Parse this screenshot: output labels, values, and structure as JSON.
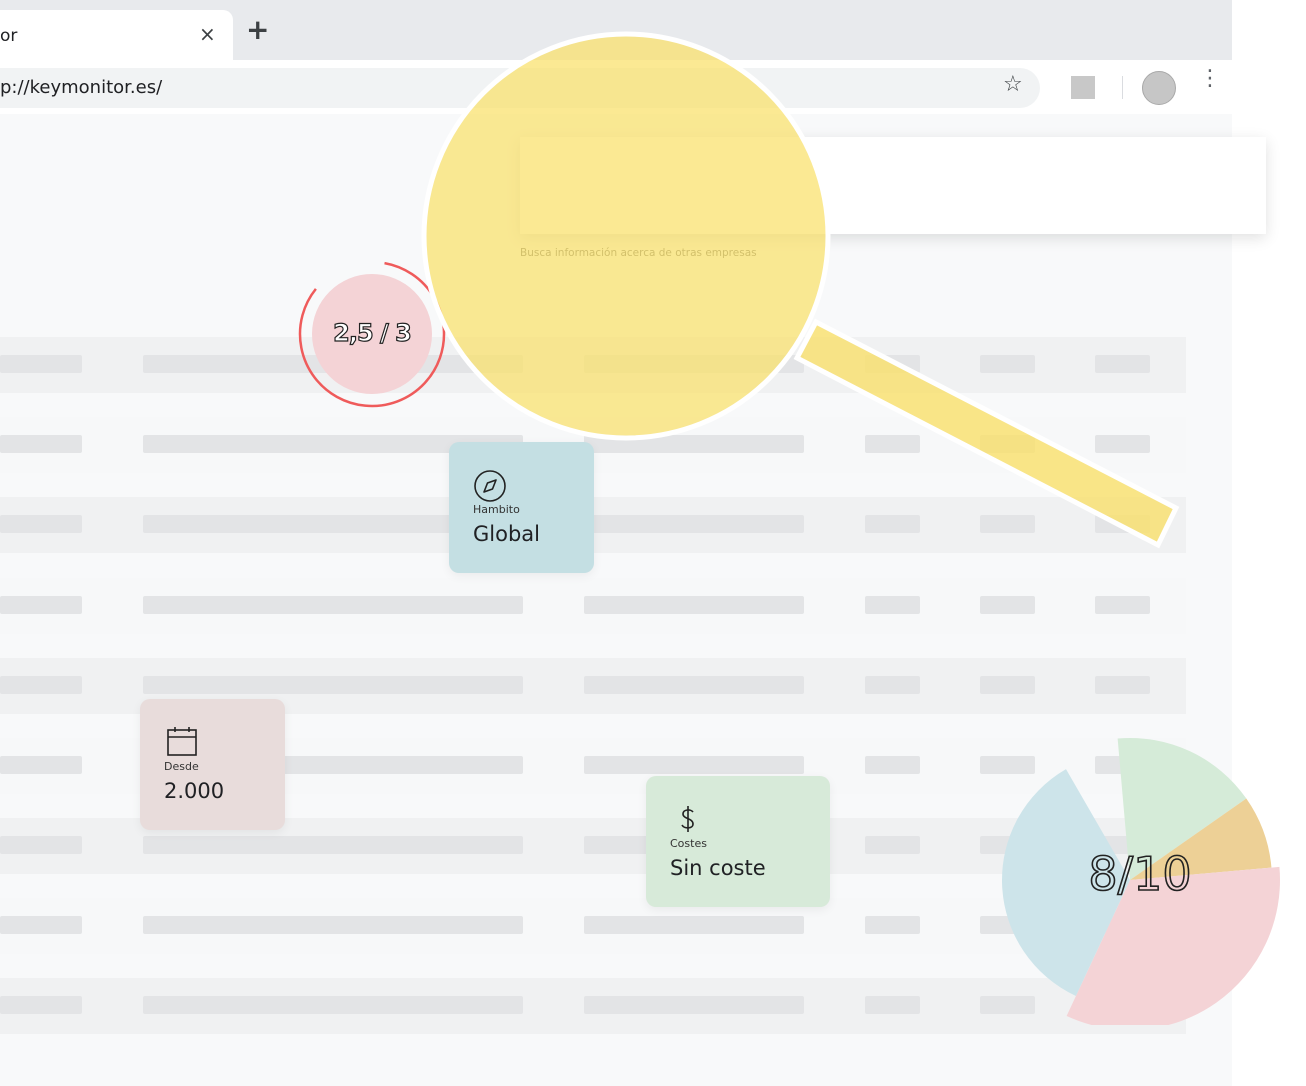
{
  "browser": {
    "tab_title": "or",
    "close_glyph": "×",
    "new_tab_glyph": "+",
    "url": "p://keymonitor.es/",
    "bookmark_glyph": "☆",
    "menu_glyph": "⋮"
  },
  "search": {
    "hint": "Busca información acerca de otras empresas"
  },
  "rating_badge": {
    "text": "2,5 / 3",
    "fill": 0.83,
    "color": "#ef5b5b"
  },
  "cards": {
    "scope": {
      "icon": "compass-icon",
      "label": "Hambito",
      "value": "Global",
      "color": "#c4dfe3"
    },
    "since": {
      "icon": "calendar-icon",
      "label": "Desde",
      "value": "2.000",
      "color": "#e8dcdb"
    },
    "costs": {
      "icon": "dollar-icon",
      "label": "Costes",
      "value": "Sin coste",
      "color": "#d7ead9"
    }
  },
  "score": {
    "text": "8/10"
  },
  "colors": {
    "magnifier": "#f9e06a",
    "pie_green": "#d5ebd8",
    "pie_orange": "#edd096",
    "pie_pink": "#f4d3d6",
    "pie_blue": "#cde4ea"
  }
}
